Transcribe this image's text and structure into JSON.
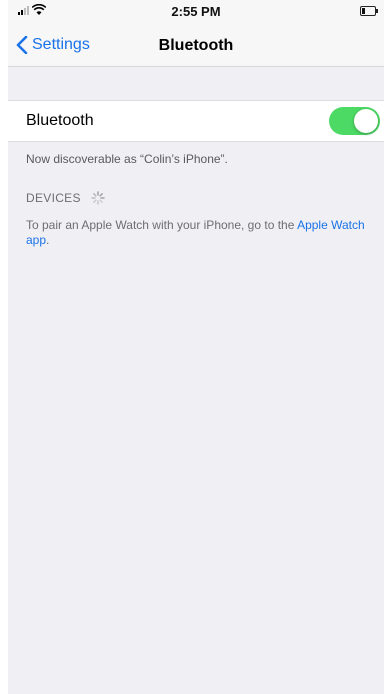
{
  "status_bar": {
    "time": "2:55 PM",
    "signal_icon": "cellular-signal-icon",
    "wifi_icon": "wifi-icon",
    "battery_icon": "battery-icon"
  },
  "nav": {
    "back_label": "Settings",
    "back_icon": "chevron-left-icon",
    "title": "Bluetooth"
  },
  "bluetooth_row": {
    "label": "Bluetooth",
    "toggle_on": true,
    "toggle_color": "#4cd964"
  },
  "discoverable_text": "Now discoverable as “Colin’s iPhone”.",
  "devices": {
    "header": "DEVICES",
    "spinner_icon": "loading-spinner-icon"
  },
  "pair_info": {
    "text": "To pair an Apple Watch with your iPhone, go to the ",
    "link": "Apple Watch app",
    "suffix": "."
  },
  "colors": {
    "accent": "#1a73e8",
    "background": "#efeff4"
  }
}
